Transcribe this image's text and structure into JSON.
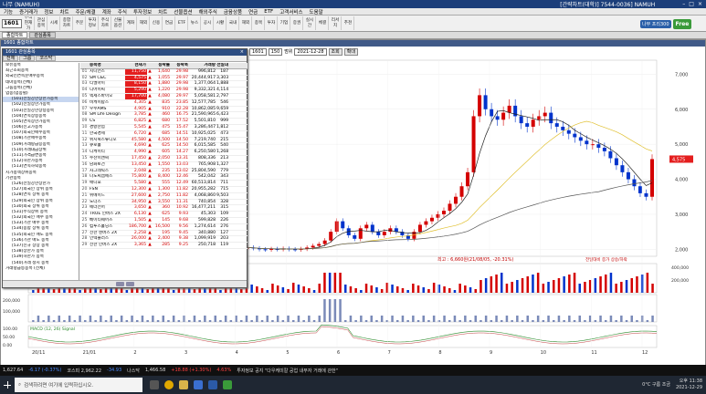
{
  "titlebar": {
    "title": "나무 (NAMUH)",
    "right_text": "[간략차트(대학)] 7544-0036] NAMUH"
  },
  "menubar": {
    "items": [
      "기능",
      "증거래가",
      "정보",
      "차트",
      "주문/체결",
      "계좌",
      "주식",
      "투자정보",
      "차트",
      "선물옵션",
      "해외주식",
      "금융상품",
      "연금",
      "ETF",
      "고객서비스",
      "도움말"
    ]
  },
  "toolbar": {
    "code": "1601",
    "buttons": [
      "주식현재가",
      "관심종목",
      "시세",
      "종합차트",
      "주문",
      "투자정보",
      "주식차트",
      "선물옵션",
      "계좌",
      "해외",
      "신용",
      "연금",
      "ETF",
      "뉴스",
      "공시",
      "시황",
      "국내",
      "해외",
      "종목",
      "투자",
      "기업",
      "증권",
      "실시간",
      "체결",
      "리서치",
      "추천"
    ]
  },
  "logo": {
    "part1": "나무 프리300",
    "part2": "Free"
  },
  "tabrow": {
    "tabs": [
      "종합차트",
      "관심종목"
    ]
  },
  "chart": {
    "title": "1601 종합차트",
    "toolbar": {
      "code": "1601",
      "period": "150",
      "date_label": "범위",
      "date_value": "2021-12-28",
      "btn1": "조회",
      "btn2": "확대"
    },
    "annotation_low": "최고 : 6,660원(21/08/05, -20.31%)",
    "annotation_right": "전일대비 증가 상승/하락",
    "price_badge": "4,575",
    "macd_label": "MACD (12, 26) Signal",
    "x_labels": [
      "20/11",
      "21/01",
      "2",
      "3",
      "4",
      "5",
      "6",
      "7",
      "8",
      "9",
      "10",
      "11",
      "12"
    ]
  },
  "chart_data": {
    "type": "candlestick",
    "y_ticks": [
      "7,000",
      "6,000",
      "5,000",
      "4,000",
      "3,000",
      "2,000"
    ],
    "ylim": [
      1800,
      7400
    ],
    "volume_ticks": [
      "400,000",
      "200,000"
    ],
    "osc_ticks": [
      "100.00",
      "50.00",
      "0.00"
    ],
    "osc_left_ticks": [
      "200,000",
      "100,000"
    ],
    "close_series": [
      2050,
      2030,
      2000,
      1990,
      2010,
      2000,
      2020,
      2000,
      1990,
      2010,
      2050,
      2100,
      2150,
      2250,
      2500,
      2800,
      2600,
      2400,
      2300,
      2600,
      2700,
      2500,
      2400,
      2500,
      2600,
      2500,
      2400,
      2300,
      2500,
      2700,
      2800,
      2900,
      3000,
      3100,
      3300,
      3500,
      3800,
      4200,
      5800,
      6400,
      6000,
      5800,
      5700,
      5900,
      6100,
      5800,
      5600,
      5500,
      5700,
      5800,
      5900,
      5600,
      5500,
      5400,
      5300,
      5200,
      5100,
      5000,
      5000,
      4900,
      4800,
      4600,
      4400,
      4200,
      4000,
      3800,
      3600,
      3500,
      4575
    ]
  },
  "panel": {
    "title": "1601 관심종목",
    "tabs": [
      "전체",
      "그룹",
      "코스닥"
    ],
    "tree": [
      {
        "t": "보유종목",
        "l": 0
      },
      {
        "t": "최근조회종목",
        "l": 0
      },
      {
        "t": "외국인연속순매수종목",
        "l": 0
      },
      {
        "t": "테마종목(전체)",
        "l": 0
      },
      {
        "t": "그룹종목(전체)",
        "l": 0
      },
      {
        "t": "업종(업종별)",
        "l": 0
      },
      {
        "t": "[501]전일강한상한가종목",
        "l": 1
      },
      {
        "t": "[502]전일상한가종목",
        "l": 1
      },
      {
        "t": "[503]전일강한상승종목",
        "l": 1
      },
      {
        "t": "[504]연속상승종목",
        "l": 1
      },
      {
        "t": "[505]연속상한가종목",
        "l": 1
      },
      {
        "t": "[506]신고가종목",
        "l": 1
      },
      {
        "t": "[507]외국인매수종목",
        "l": 1
      },
      {
        "t": "[508]기관매수종목",
        "l": 1
      },
      {
        "t": "[509]거래량급증종목",
        "l": 1
      },
      {
        "t": "[510]거래대금상위",
        "l": 1
      },
      {
        "t": "[511]가격급변종목",
        "l": 1
      },
      {
        "t": "[512]하한가종목",
        "l": 1
      },
      {
        "t": "[513]연속하락종목",
        "l": 1
      },
      {
        "t": "시가총액상위종목",
        "l": 0
      },
      {
        "t": "기관종목",
        "l": 0
      },
      {
        "t": "[526]전일강한상한가",
        "l": 1
      },
      {
        "t": "[527]외국인 상위 종목",
        "l": 1
      },
      {
        "t": "[528]연속 상위 종목",
        "l": 1
      },
      {
        "t": "[529]외국인 상위 종목",
        "l": 1
      },
      {
        "t": "[530]외국 상위 종목",
        "l": 1
      },
      {
        "t": "[531]주식상위 종목",
        "l": 1
      },
      {
        "t": "[532]외국인 매수 종목",
        "l": 1
      },
      {
        "t": "[533]기관 매수 종목",
        "l": 1
      },
      {
        "t": "[534]종합 상위 종목",
        "l": 1
      },
      {
        "t": "[535]외국인 매도 종목",
        "l": 1
      },
      {
        "t": "[536]기관 매도 종목",
        "l": 1
      },
      {
        "t": "[537]신규 상장 종목",
        "l": 1
      },
      {
        "t": "[538]상한가 종목",
        "l": 1
      },
      {
        "t": "[539]하한가 종목",
        "l": 1
      },
      {
        "t": "[540]거래 정지 종목",
        "l": 1
      },
      {
        "t": "거래량급등종목 (전체)",
        "l": 0
      }
    ],
    "headers": [
      "",
      "종목명",
      "현재가",
      "",
      "등락률",
      "등락폭",
      "거래량",
      "전일대"
    ],
    "rows": [
      {
        "i": "01",
        "n": "지니언스",
        "p": "11,750",
        "s": "▲",
        "r": "1,640",
        "d": "29.98",
        "v": "996,812",
        "x": "187",
        "h": true
      },
      {
        "i": "02",
        "n": "SM C&C",
        "p": "4,575",
        "s": "▲",
        "r": "1,055",
        "d": "29.97",
        "v": "20,444,917",
        "x": "3,303",
        "h": true
      },
      {
        "i": "03",
        "n": "티엘아이",
        "p": "8,150",
        "s": "▲",
        "r": "1,880",
        "d": "29.98",
        "v": "1,377,064",
        "x": "1,888",
        "h": true
      },
      {
        "i": "04",
        "n": "디어이씨",
        "p": "5,290",
        "s": "▲",
        "r": "1,220",
        "d": "29.98",
        "v": "9,332,321",
        "x": "4,114",
        "h": true
      },
      {
        "i": "05",
        "n": "엑세스바이오",
        "p": "17,700",
        "s": "▲",
        "r": "4,080",
        "d": "29.97",
        "v": "5,058,581",
        "x": "2,797",
        "h": true
      },
      {
        "i": "06",
        "n": "비케이탑스",
        "p": "4,305",
        "s": "▲",
        "r": "835",
        "d": "23.85",
        "v": "12,577,785",
        "x": "546",
        "h": false
      },
      {
        "i": "07",
        "n": "우수AMS",
        "p": "4,905",
        "s": "▲",
        "r": "910",
        "d": "22.28",
        "v": "10,862,085",
        "x": "9,659",
        "h": false
      },
      {
        "i": "08",
        "n": "SM Life Design",
        "p": "3,785",
        "s": "▲",
        "r": "460",
        "d": "16.75",
        "v": "21,590,965",
        "x": "6,423",
        "h": false
      },
      {
        "i": "09",
        "n": "CS",
        "p": "6,825",
        "s": "▲",
        "r": "680",
        "d": "17.52",
        "v": "5,501,810",
        "x": "999",
        "h": false
      },
      {
        "i": "10",
        "n": "경방산업",
        "p": "5,545",
        "s": "▲",
        "r": "475",
        "d": "15.47",
        "v": "3,286,447",
        "x": "1,812",
        "h": false
      },
      {
        "i": "11",
        "n": "한국경제",
        "p": "6,720",
        "s": "▲",
        "r": "685",
        "d": "14.51",
        "v": "10,925,025",
        "x": "473",
        "h": false
      },
      {
        "i": "12",
        "n": "위지윅스튜디오",
        "p": "45,580",
        "s": "▲",
        "r": "4,500",
        "d": "14.50",
        "v": "7,219,740",
        "x": "215",
        "h": false
      },
      {
        "i": "13",
        "n": "큐로홀",
        "p": "4,690",
        "s": "▲",
        "r": "625",
        "d": "14.50",
        "v": "6,015,585",
        "x": "540",
        "h": false
      },
      {
        "i": "14",
        "n": "디케이티",
        "p": "4,990",
        "s": "▲",
        "r": "605",
        "d": "14.27",
        "v": "6,250,580",
        "x": "1,268",
        "h": false
      },
      {
        "i": "15",
        "n": "수산이앤씨",
        "p": "17,450",
        "s": "▲",
        "r": "2,050",
        "d": "13.31",
        "v": "808,336",
        "x": "213",
        "h": false
      },
      {
        "i": "16",
        "n": "남화토건",
        "p": "13,450",
        "s": "▲",
        "r": "1,550",
        "d": "13.03",
        "v": "765,908",
        "x": "1,327",
        "h": false
      },
      {
        "i": "17",
        "n": "자그네틱스",
        "p": "2,048",
        "s": "▲",
        "r": "235",
        "d": "13.02",
        "v": "25,804,590",
        "x": "779",
        "h": false
      },
      {
        "i": "18",
        "n": "나노씨엠에스",
        "p": "75,800",
        "s": "▲",
        "r": "8,400",
        "d": "12.46",
        "v": "542,042",
        "x": "343",
        "h": false
      },
      {
        "i": "19",
        "n": "애니포",
        "p": "5,580",
        "s": "▲",
        "r": "555",
        "d": "12.49",
        "v": "60,513,814",
        "x": "711",
        "h": false
      },
      {
        "i": "20",
        "n": "FSN",
        "p": "12,300",
        "s": "▲",
        "r": "1,300",
        "d": "11.82",
        "v": "20,955,282",
        "x": "715",
        "h": false
      },
      {
        "i": "21",
        "n": "위메이드",
        "p": "27,600",
        "s": "▲",
        "r": "2,750",
        "d": "11.82",
        "v": "4,068,860",
        "x": "9,503",
        "h": false
      },
      {
        "i": "22",
        "n": "노더스",
        "p": "34,950",
        "s": "▲",
        "r": "3,550",
        "d": "11.31",
        "v": "740,854",
        "x": "328",
        "h": false
      },
      {
        "i": "23",
        "n": "에너전어",
        "p": "3,650",
        "s": "▲",
        "r": "360",
        "d": "10.92",
        "v": "16,477,211",
        "x": "315",
        "h": false
      },
      {
        "i": "24",
        "n": "TRUE 인버스 2X",
        "p": "6,130",
        "s": "▲",
        "r": "625",
        "d": "9.93",
        "v": "45,303",
        "x": "109",
        "h": false
      },
      {
        "i": "25",
        "n": "베이티쉐어즈",
        "p": "1,505",
        "s": "▲",
        "r": "145",
        "d": "9.68",
        "v": "599,828",
        "x": "226",
        "h": false
      },
      {
        "i": "26",
        "n": "컴투스홀딩스",
        "p": "186,700",
        "s": "▲",
        "r": "16,500",
        "d": "9.56",
        "v": "1,274,614",
        "x": "276",
        "h": false
      },
      {
        "i": "27",
        "n": "선한 엔버스 2X",
        "p": "2,258",
        "s": "▲",
        "r": "195",
        "d": "9.45",
        "v": "340,880",
        "x": "127",
        "h": false
      },
      {
        "i": "28",
        "n": "인텍플러스",
        "p": "26,000",
        "s": "▲",
        "r": "2,400",
        "d": "9.38",
        "v": "1,099,919",
        "x": "203",
        "h": false
      },
      {
        "i": "29",
        "n": "선한 인버스 2X",
        "p": "3,365",
        "s": "▲",
        "r": "285",
        "d": "9.25",
        "v": "250,718",
        "x": "119",
        "h": false
      }
    ]
  },
  "statusbar": {
    "items": [
      "1,627.64",
      "-6.17 (-0.37%)",
      "코스피 2,962.22",
      "-34.93",
      "나스닥",
      "1,466.58",
      "+18.88 (+1.30%)",
      "4.63%",
      "투자정보 공지 \"다우케미칼 공업 내부자 거래에 관한\""
    ]
  },
  "taskbar": {
    "search_placeholder": "검색하려면 여기에 입력하십시오.",
    "time": "오후 11:38",
    "date": "2021-12-29",
    "tray_text": "0°C 구름 조금"
  }
}
